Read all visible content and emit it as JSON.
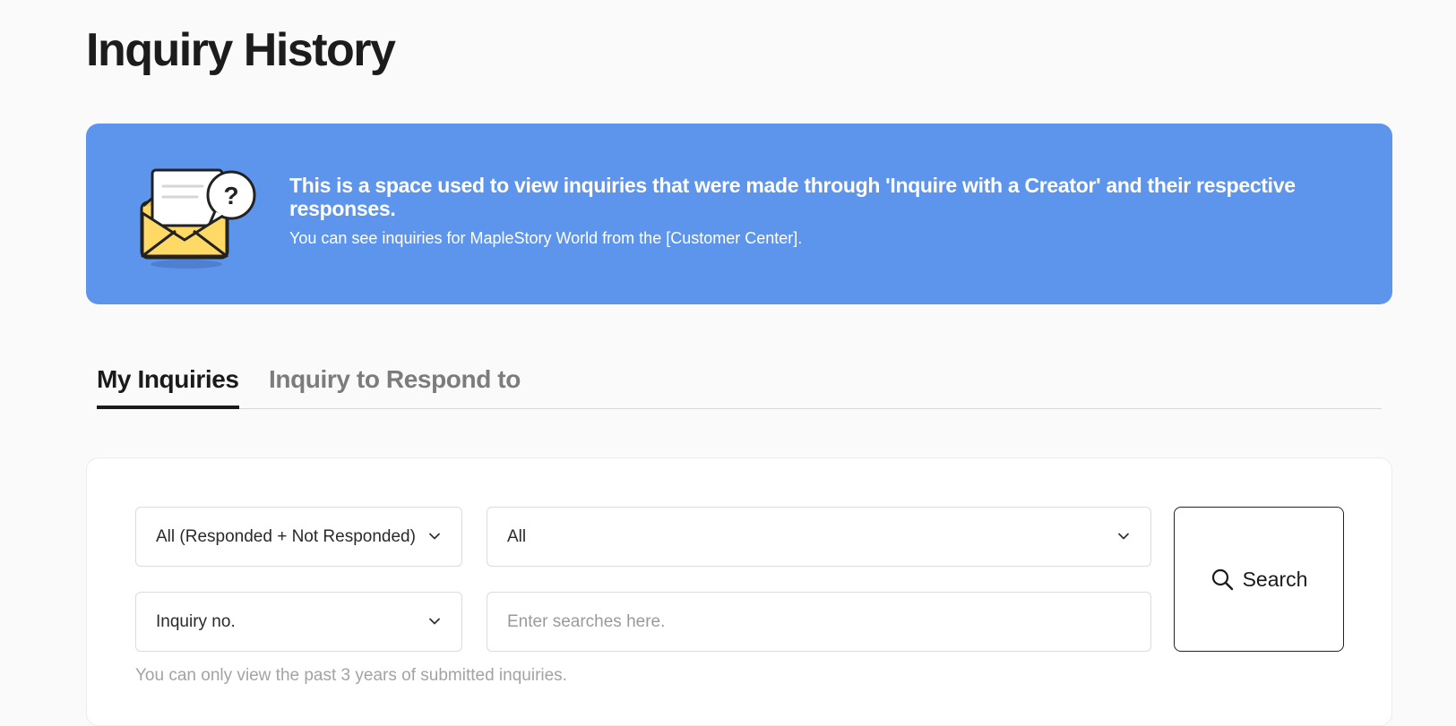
{
  "page": {
    "title": "Inquiry History"
  },
  "banner": {
    "headline": "This is a space used to view inquiries that were made through 'Inquire with a Creator' and their respective responses.",
    "subtext": "You can see inquiries for MapleStory World from the [Customer Center].",
    "illustration": "envelope-question-icon",
    "background_color": "#5e95ec"
  },
  "tabs": [
    {
      "label": "My Inquiries",
      "active": true
    },
    {
      "label": "Inquiry to Respond to",
      "active": false
    }
  ],
  "filters": {
    "response_status": {
      "selected": "All (Responded + Not Responded)"
    },
    "category": {
      "selected": "All"
    },
    "search_type": {
      "selected": "Inquiry no."
    },
    "search_input": {
      "placeholder": "Enter searches here.",
      "value": ""
    }
  },
  "search_button": {
    "label": "Search",
    "icon": "search-icon"
  },
  "hint": "You can only view the past 3 years of submitted inquiries."
}
